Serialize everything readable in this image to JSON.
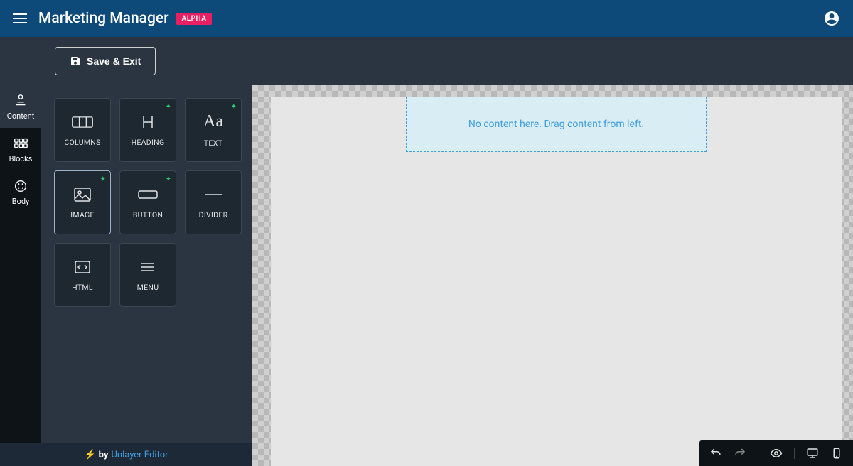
{
  "header": {
    "title": "Marketing Manager",
    "badge": "ALPHA"
  },
  "actions": {
    "save_exit": "Save & Exit"
  },
  "side_tabs": {
    "content": "Content",
    "blocks": "Blocks",
    "body": "Body"
  },
  "tools": {
    "columns": "COLUMNS",
    "heading": "HEADING",
    "text": "TEXT",
    "image": "IMAGE",
    "button": "BUTTON",
    "divider": "DIVIDER",
    "html": "HTML",
    "menu": "MENU"
  },
  "canvas": {
    "empty_msg": "No content here. Drag content from left."
  },
  "footer": {
    "by": "by",
    "link_text": "Unlayer Editor"
  }
}
